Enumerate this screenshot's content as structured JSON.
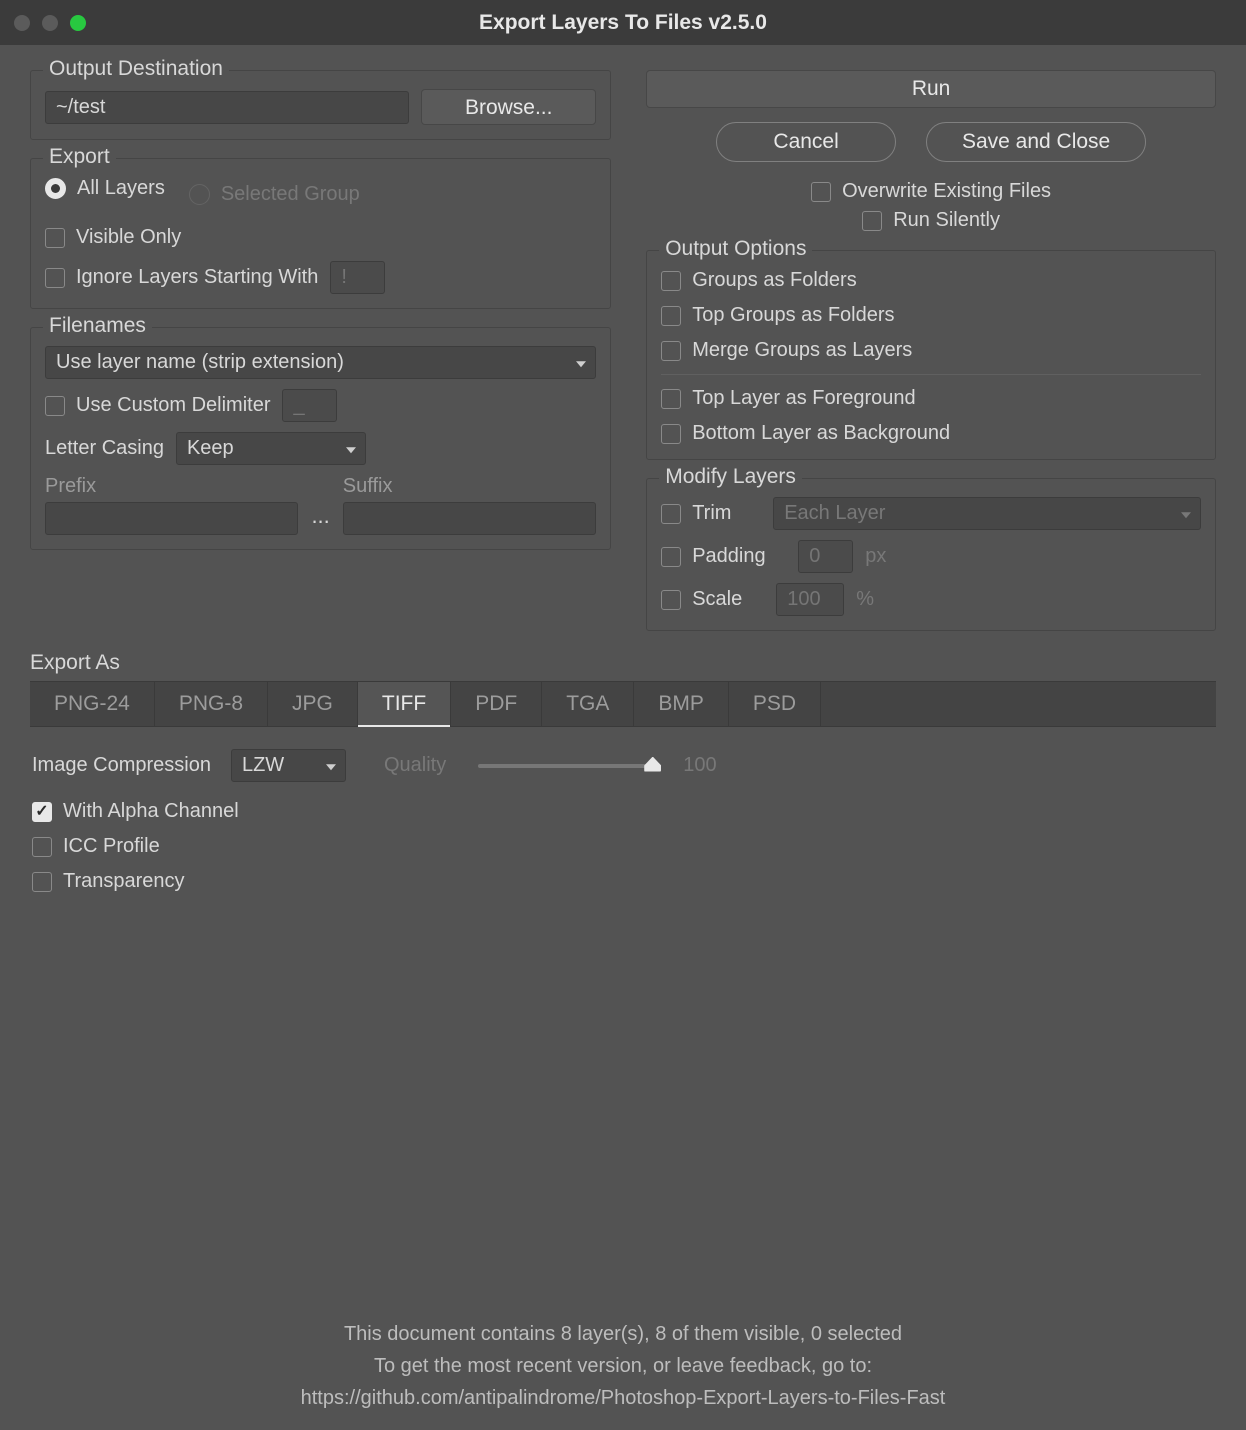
{
  "window": {
    "title": "Export Layers To Files v2.5.0"
  },
  "output_destination": {
    "legend": "Output Destination",
    "path": "~/test",
    "browse": "Browse..."
  },
  "export": {
    "legend": "Export",
    "all_layers": "All Layers",
    "selected_group": "Selected Group",
    "visible_only": "Visible Only",
    "ignore_prefix_label": "Ignore Layers Starting With",
    "ignore_prefix_placeholder": "!"
  },
  "filenames": {
    "legend": "Filenames",
    "template": "Use layer name (strip extension)",
    "use_custom_delimiter": "Use Custom Delimiter",
    "delimiter_value": "_",
    "letter_casing_label": "Letter Casing",
    "letter_casing_value": "Keep",
    "prefix_label": "Prefix",
    "suffix_label": "Suffix"
  },
  "actions": {
    "run": "Run",
    "cancel": "Cancel",
    "save_close": "Save and Close",
    "overwrite": "Overwrite Existing Files",
    "run_silently": "Run Silently"
  },
  "output_options": {
    "legend": "Output Options",
    "groups_as_folders": "Groups as Folders",
    "top_groups_as_folders": "Top Groups as Folders",
    "merge_groups": "Merge Groups as Layers",
    "top_layer_fg": "Top Layer as Foreground",
    "bottom_layer_bg": "Bottom Layer as Background"
  },
  "modify_layers": {
    "legend": "Modify Layers",
    "trim": "Trim",
    "trim_value": "Each Layer",
    "padding": "Padding",
    "padding_value": "0",
    "padding_unit": "px",
    "scale": "Scale",
    "scale_value": "100",
    "scale_unit": "%"
  },
  "export_as": {
    "label": "Export As",
    "tabs": [
      "PNG-24",
      "PNG-8",
      "JPG",
      "TIFF",
      "PDF",
      "TGA",
      "BMP",
      "PSD"
    ],
    "active_tab": "TIFF",
    "compression_label": "Image Compression",
    "compression_value": "LZW",
    "quality_label": "Quality",
    "quality_value": "100",
    "with_alpha": "With Alpha Channel",
    "icc_profile": "ICC Profile",
    "transparency": "Transparency"
  },
  "footer": {
    "line1": "This document contains 8 layer(s), 8 of them visible, 0 selected",
    "line2": "To get the most recent version, or leave feedback, go to:",
    "line3": "https://github.com/antipalindrome/Photoshop-Export-Layers-to-Files-Fast"
  }
}
